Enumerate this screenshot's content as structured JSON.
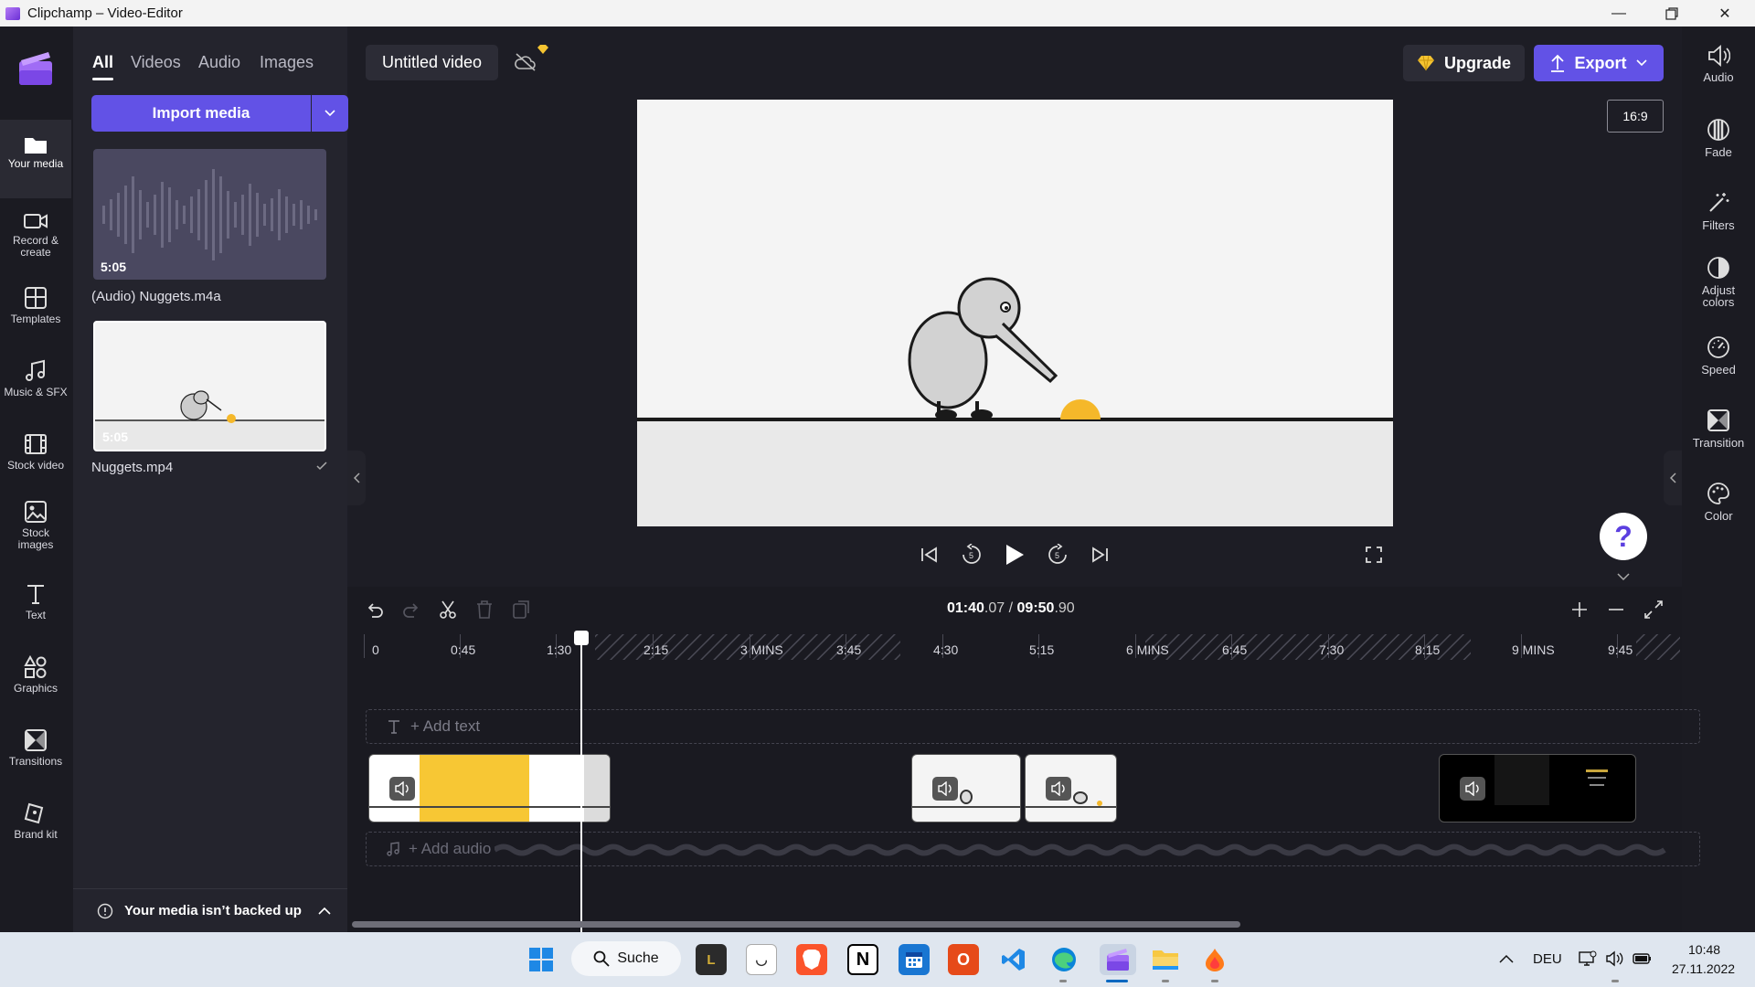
{
  "window": {
    "title": "Clipchamp – Video-Editor"
  },
  "left_nav": {
    "items": [
      {
        "label": "Your media",
        "icon": "folder-icon",
        "active": true
      },
      {
        "label": "Record &\ncreate",
        "icon": "camera-icon"
      },
      {
        "label": "Templates",
        "icon": "templates-icon"
      },
      {
        "label": "Music & SFX",
        "icon": "music-note-icon"
      },
      {
        "label": "Stock video",
        "icon": "film-icon"
      },
      {
        "label": "Stock\nimages",
        "icon": "image-icon"
      },
      {
        "label": "Text",
        "icon": "text-icon"
      },
      {
        "label": "Graphics",
        "icon": "shapes-icon"
      },
      {
        "label": "Transitions",
        "icon": "transition-icon"
      },
      {
        "label": "Brand kit",
        "icon": "brand-kit-icon"
      }
    ]
  },
  "media_panel": {
    "tabs": [
      "All",
      "Videos",
      "Audio",
      "Images"
    ],
    "active_tab": "All",
    "import_label": "Import media",
    "items": [
      {
        "name": "(Audio) Nuggets.m4a",
        "duration": "5:05"
      },
      {
        "name": "Nuggets.mp4",
        "duration": "5:05"
      }
    ],
    "backup_status": "Your media isn’t backed up"
  },
  "header": {
    "project_title": "Untitled video",
    "upgrade_label": "Upgrade",
    "export_label": "Export",
    "aspect_ratio": "16:9"
  },
  "right_panel": {
    "items": [
      {
        "label": "Audio",
        "icon": "speaker-icon"
      },
      {
        "label": "Fade",
        "icon": "fade-icon"
      },
      {
        "label": "Filters",
        "icon": "magic-wand-icon"
      },
      {
        "label": "Adjust\ncolors",
        "icon": "contrast-icon"
      },
      {
        "label": "Speed",
        "icon": "speedometer-icon"
      },
      {
        "label": "Transition",
        "icon": "transition-icon"
      },
      {
        "label": "Color",
        "icon": "palette-icon"
      }
    ]
  },
  "timeline": {
    "current_time": "01:40.07",
    "current_time_frac": "07",
    "current_time_main": "01:40",
    "total_time_main": "09:50",
    "total_time_frac": "90",
    "separator": " / ",
    "ticks": [
      "0",
      "0:45",
      "1:30",
      "2:15",
      "3 MINS",
      "3:45",
      "4:30",
      "5:15",
      "6 MINS",
      "6:45",
      "7:30",
      "8:15",
      "9 MINS",
      "9:45"
    ],
    "add_text_label": "+ Add text",
    "add_audio_label": "+ Add audio"
  },
  "taskbar": {
    "search_label": "Suche",
    "language": "DEU",
    "time": "10:48",
    "date": "27.11.2022"
  }
}
